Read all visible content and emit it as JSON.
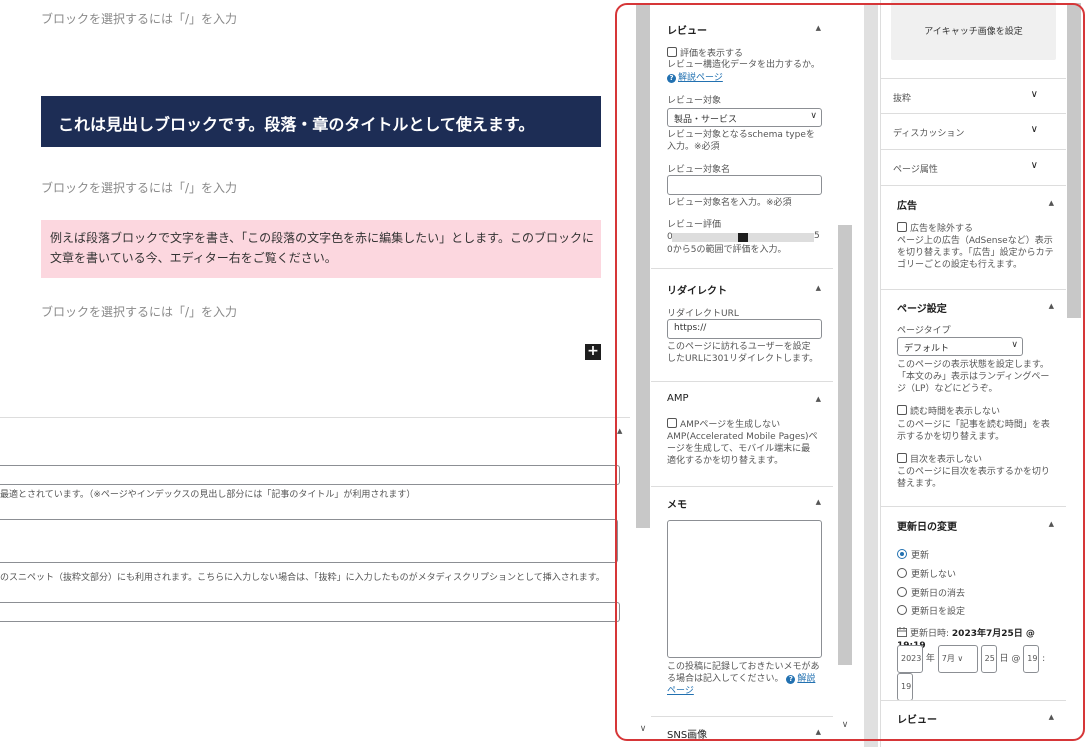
{
  "editor": {
    "placeholder": "ブロックを選択するには「/」を入力",
    "heading_text": "これは見出しブロックです。段落・章のタイトルとして使えます。",
    "paragraph_text": "例えば段落ブロックで文字を書き、「この段落の文字色を赤に編集したい」とします。このブロックに文章を書いている今、エディター右をご覧ください。",
    "add_block": "+"
  },
  "meta_box": {
    "help_title": "最適とされています。（※ページやインデックスの見出し部分には「記事のタイトル」が利用されます）",
    "help_description": "のスニペット（抜粋文部分）にも利用されます。こちらに入力しない場合は、「抜粋」に入力したものがメタディスクリプションとして挿入されます。",
    "collapse_icon": "▲"
  },
  "middle_panel": {
    "review": {
      "title": "レビュー",
      "show_rating": "評価を表示する",
      "show_rating_help": "レビュー構造化データを出力するか。",
      "help_link": "解説ページ",
      "target_label": "レビュー対象",
      "target_value": "製品・サービス",
      "target_help": "レビュー対象となるschema typeを入力。※必須",
      "name_label": "レビュー対象名",
      "name_help": "レビュー対象名を入力。※必須",
      "rating_label": "レビュー評価",
      "rating_min": "0",
      "rating_max": "5",
      "rating_value": 2.5,
      "rating_help": "0から5の範囲で評価を入力。"
    },
    "redirect": {
      "title": "リダイレクト",
      "url_label": "リダイレクトURL",
      "url_value": "https://",
      "help": "このページに訪れるユーザーを設定したURLに301リダイレクトします。"
    },
    "amp": {
      "title": "AMP",
      "checkbox": "AMPページを生成しない",
      "help": "AMP(Accelerated Mobile Pages)ページを生成して、モバイル端末に最適化するかを切り替えます。"
    },
    "memo": {
      "title": "メモ",
      "help": "この投稿に記録しておきたいメモがある場合は記入してください。",
      "help_link": "解説ページ"
    },
    "sns": {
      "title": "SNS画像"
    }
  },
  "right_panel": {
    "featured_image": "アイキャッチ画像を設定",
    "excerpt": "抜粋",
    "discussion": "ディスカッション",
    "page_attributes": "ページ属性",
    "ads": {
      "title": "広告",
      "checkbox": "広告を除外する",
      "help": "ページ上の広告（AdSenseなど）表示を切り替えます。「広告」設定からカテゴリーごとの設定も行えます。"
    },
    "page_settings": {
      "title": "ページ設定",
      "type_label": "ページタイプ",
      "type_value": "デフォルト",
      "type_help": "このページの表示状態を設定します。「本文のみ」表示はランディングページ（LP）などにどうぞ。",
      "read_time": "読む時間を表示しない",
      "read_time_help": "このページに「記事を読む時間」を表示するかを切り替えます。",
      "toc": "目次を表示しない",
      "toc_help": "このページに目次を表示するかを切り替えます。"
    },
    "update_date": {
      "title": "更新日の変更",
      "options": [
        "更新",
        "更新しない",
        "更新日の消去",
        "更新日を設定"
      ],
      "selected": "更新",
      "current_label": "更新日時:",
      "current_value": "2023年7月25日 @ 19:19",
      "year": "2023",
      "year_unit": "年",
      "month": "7月",
      "day": "25",
      "day_unit": "日 @",
      "hour": "19",
      "colon": ":",
      "minute": "19"
    },
    "review_title": "レビュー"
  },
  "icons": {
    "caret_up": "▲",
    "chevron_down": "∨",
    "calendar": "calendar-icon",
    "help": "help-icon"
  },
  "colors": {
    "heading_bg": "#1d2d55",
    "paragraph_bg": "#fcd7df",
    "highlight_border": "#d63638",
    "link": "#2271b1"
  }
}
